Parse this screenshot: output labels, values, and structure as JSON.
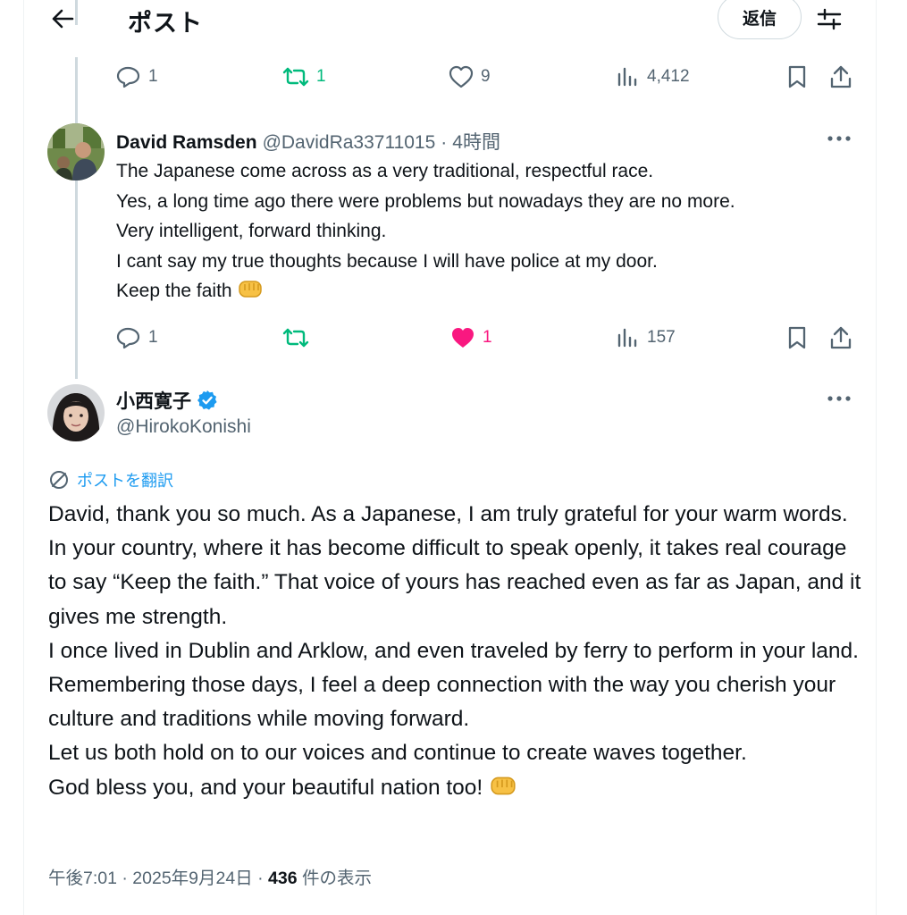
{
  "header": {
    "title": "ポスト",
    "reply_label": "返信"
  },
  "top_tweet_actions": {
    "replies": "1",
    "reposts": "1",
    "likes": "9",
    "views": "4,412"
  },
  "reply_tweet": {
    "name": "David Ramsden",
    "handle": "@DavidRa33711015",
    "separator": "·",
    "time": "4時間",
    "text": "The Japanese come across as a very traditional,  respectful race.\nYes, a long time ago there were problems but nowadays they are no more.\nVery intelligent, forward thinking.\nI cant say my true thoughts because I will have police at my door.\nKeep the faith",
    "actions": {
      "replies": "1",
      "reposts": "",
      "likes": "1",
      "views": "157"
    }
  },
  "main_tweet": {
    "name": "小西寛子",
    "handle": "@HirokoKonishi",
    "translate_label": "ポストを翻訳",
    "text": "David, thank you so much. As a Japanese, I am truly grateful for your warm words.\nIn your country, where it has become difficult to speak openly, it takes real courage to say “Keep the faith.” That voice of yours has reached even as far as Japan, and it gives me strength.\nI once lived in Dublin and Arklow, and even traveled by ferry to perform in your land. Remembering those days, I feel a deep connection with the way you cherish your culture and traditions while moving forward.\nLet us both hold on to our voices and continue to create waves together.\nGod bless you, and your beautiful nation too!",
    "meta_time": "午後7:01 · 2025年9月24日 · ",
    "meta_views": "436",
    "meta_views_label": " 件の表示"
  },
  "colors": {
    "accent": "#1d9bf0",
    "repost_green": "#00ba7c",
    "like_pink": "#f91880",
    "secondary_text": "#536471"
  },
  "icons": [
    "back-arrow-icon",
    "filter-sliders-icon",
    "reply-icon",
    "repost-icon",
    "like-heart-icon",
    "views-chart-icon",
    "bookmark-icon",
    "share-icon",
    "more-dots-icon",
    "verified-badge-icon",
    "translate-globe-icon",
    "oncoming-fist-emoji"
  ]
}
